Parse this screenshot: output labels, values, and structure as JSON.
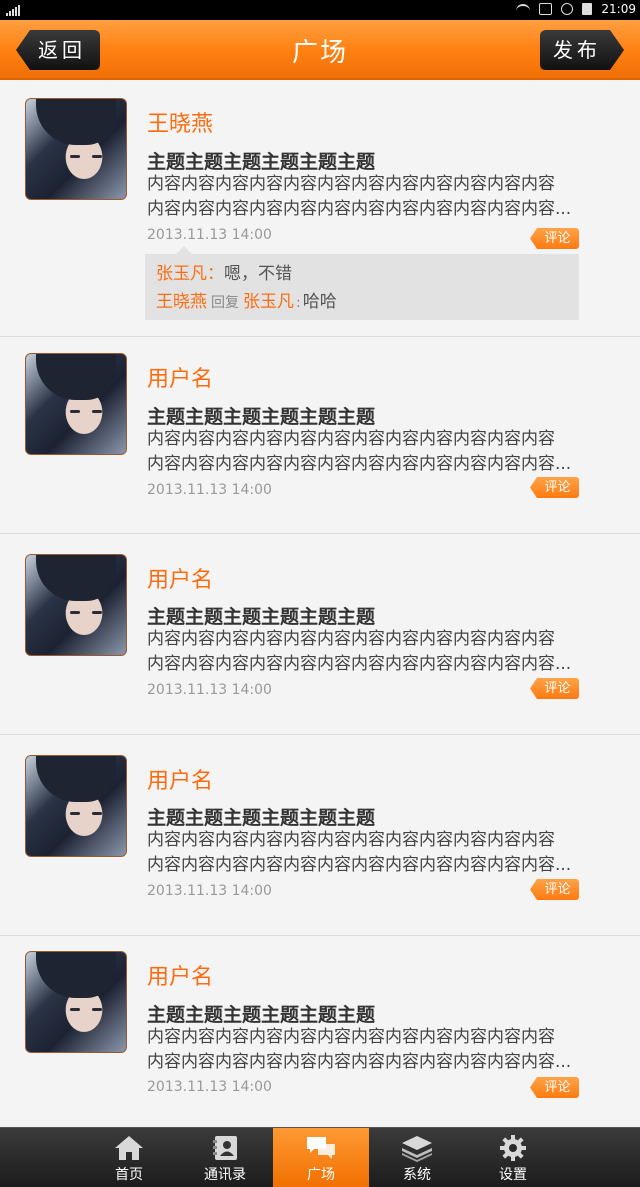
{
  "status": {
    "time": "21:09"
  },
  "header": {
    "back_label": "返回",
    "title": "广场",
    "publish_label": "发布"
  },
  "posts": [
    {
      "username": "王晓燕",
      "subject": "主题主题主题主题主题主题",
      "body_line1": "内容内容内容内容内容内容内容内容内容内容内容内容",
      "body_line2": "内容内容内容内容内容内容内容内容内容内容内容内容...",
      "date": "2013.11.13 14:00",
      "comment_label": "评论",
      "comments": [
        {
          "author": "张玉凡",
          "sep": "：",
          "text": "嗯，不错"
        },
        {
          "author": "王晓燕",
          "reply_word": "回复",
          "target": "张玉凡",
          "sep": ":",
          "text": "哈哈"
        }
      ]
    },
    {
      "username": "用户名",
      "subject": "主题主题主题主题主题主题",
      "body_line1": "内容内容内容内容内容内容内容内容内容内容内容内容",
      "body_line2": "内容内容内容内容内容内容内容内容内容内容内容内容...",
      "date": "2013.11.13 14:00",
      "comment_label": "评论"
    },
    {
      "username": "用户名",
      "subject": "主题主题主题主题主题主题",
      "body_line1": "内容内容内容内容内容内容内容内容内容内容内容内容",
      "body_line2": "内容内容内容内容内容内容内容内容内容内容内容内容...",
      "date": "2013.11.13 14:00",
      "comment_label": "评论"
    },
    {
      "username": "用户名",
      "subject": "主题主题主题主题主题主题",
      "body_line1": "内容内容内容内容内容内容内容内容内容内容内容内容",
      "body_line2": "内容内容内容内容内容内容内容内容内容内容内容内容...",
      "date": "2013.11.13 14:00",
      "comment_label": "评论"
    },
    {
      "username": "用户名",
      "subject": "主题主题主题主题主题主题",
      "body_line1": "内容内容内容内容内容内容内容内容内容内容内容内容",
      "body_line2": "内容内容内容内容内容内容内容内容内容内容内容内容...",
      "date": "2013.11.13 14:00",
      "comment_label": "评论"
    }
  ],
  "tabs": [
    {
      "label": "首页",
      "icon": "home-icon"
    },
    {
      "label": "通讯录",
      "icon": "contacts-icon"
    },
    {
      "label": "广场",
      "icon": "chat-icon",
      "active": true
    },
    {
      "label": "系统",
      "icon": "layers-icon"
    },
    {
      "label": "设置",
      "icon": "gear-icon"
    }
  ],
  "colors": {
    "accent": "#ff7f10",
    "username": "#ff6c10",
    "dark_button": "#1a1a1a"
  }
}
